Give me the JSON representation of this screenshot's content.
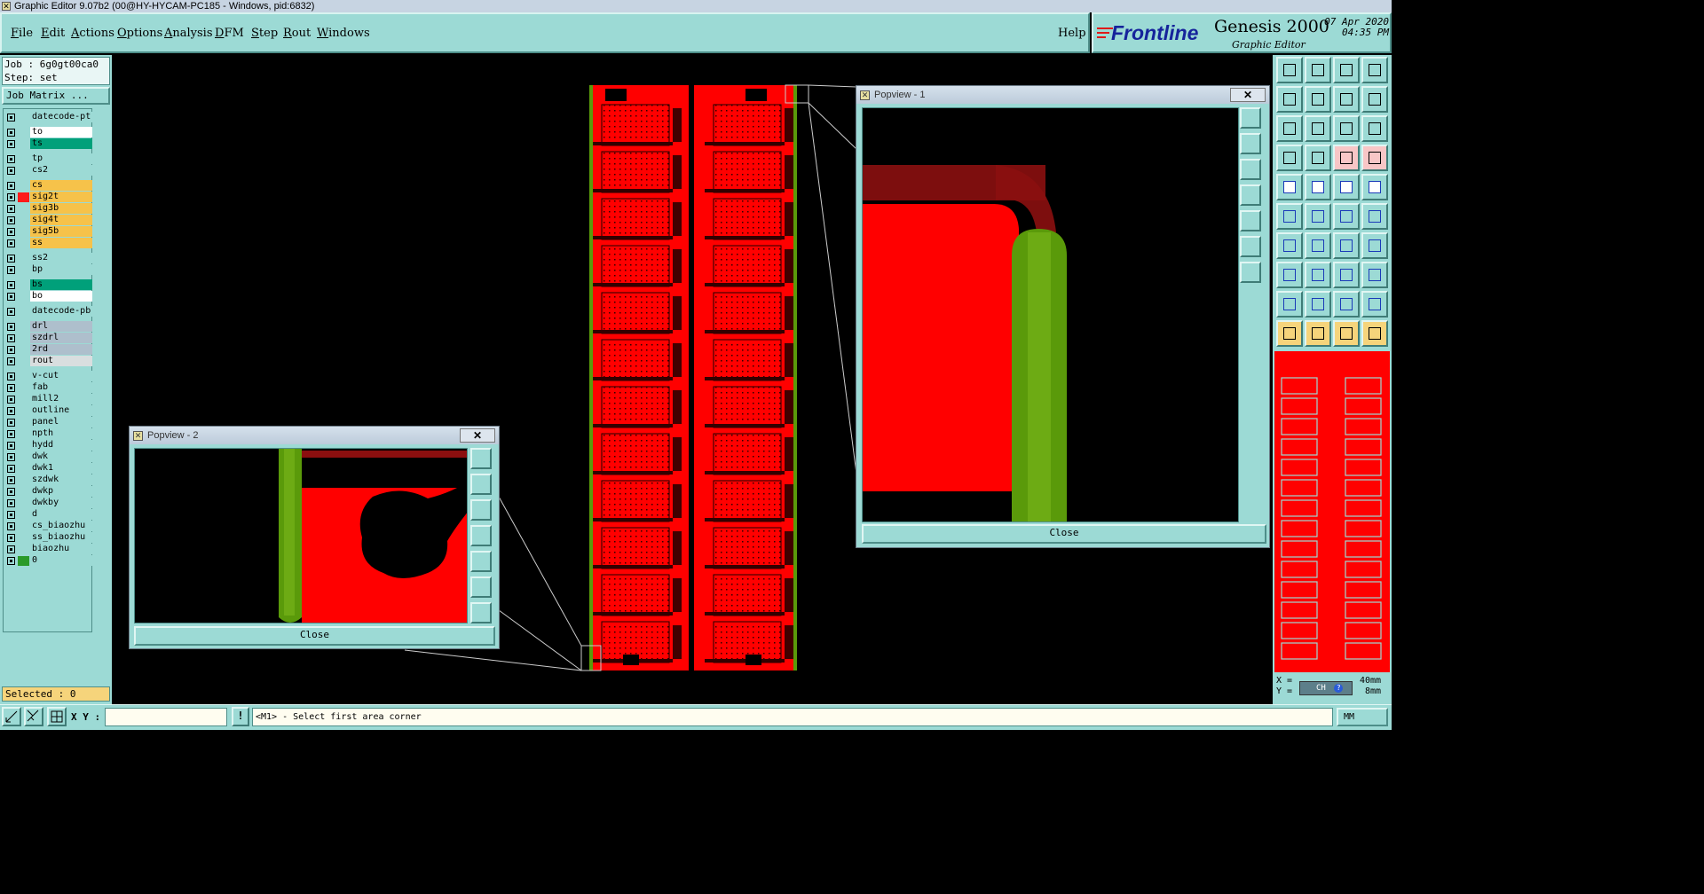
{
  "window": {
    "title": "Graphic Editor 9.07b2 (00@HY-HYCAM-PC185 - Windows, pid:6832)"
  },
  "menu": [
    {
      "label": "File",
      "ul": "F",
      "rest": "ile"
    },
    {
      "label": "Edit",
      "ul": "E",
      "rest": "dit"
    },
    {
      "label": "Actions",
      "ul": "A",
      "rest": "ctions"
    },
    {
      "label": "Options",
      "ul": "O",
      "rest": "ptions"
    },
    {
      "label": "Analysis",
      "ul": "A",
      "rest": "nalysis"
    },
    {
      "label": "DFM",
      "ul": "D",
      "rest": "FM"
    },
    {
      "label": "Step",
      "ul": "S",
      "rest": "tep"
    },
    {
      "label": "Rout",
      "ul": "R",
      "rest": "out"
    },
    {
      "label": "Windows",
      "ul": "W",
      "rest": "indows"
    }
  ],
  "help_label": "Help",
  "brand": {
    "logo": "Frontline",
    "product": "Genesis 2000",
    "editor": "Graphic Editor",
    "date": "07 Apr 2020",
    "time": "04:35 PM"
  },
  "job": {
    "job_line": "Job : 6g0gt00ca0",
    "step_line": "Step: set",
    "matrix_button": "Job Matrix ..."
  },
  "layers": [
    {
      "name": "datecode-pt",
      "color": "#9cdad5",
      "row_bg": "#9cdad5"
    },
    {
      "name": "to",
      "color": "#9cdad5",
      "row_bg": "#ffffff"
    },
    {
      "name": "ts",
      "color": "#9cdad5",
      "row_bg": "#00a07a"
    },
    {
      "name": "tp",
      "color": "#9cdad5",
      "row_bg": "#9cdad5"
    },
    {
      "name": "cs2",
      "color": "#9cdad5",
      "row_bg": "#9cdad5"
    },
    {
      "name": "cs",
      "color": "#9cdad5",
      "row_bg": "#f6c24a"
    },
    {
      "name": "sig2t",
      "color": "#ff1a1a",
      "row_bg": "#f6c24a"
    },
    {
      "name": "sig3b",
      "color": "#9cdad5",
      "row_bg": "#f6c24a"
    },
    {
      "name": "sig4t",
      "color": "#9cdad5",
      "row_bg": "#f6c24a"
    },
    {
      "name": "sig5b",
      "color": "#9cdad5",
      "row_bg": "#f6c24a"
    },
    {
      "name": "ss",
      "color": "#9cdad5",
      "row_bg": "#f6c24a"
    },
    {
      "name": "ss2",
      "color": "#9cdad5",
      "row_bg": "#9cdad5"
    },
    {
      "name": "bp",
      "color": "#9cdad5",
      "row_bg": "#9cdad5"
    },
    {
      "name": "bs",
      "color": "#9cdad5",
      "row_bg": "#00a07a"
    },
    {
      "name": "bo",
      "color": "#9cdad5",
      "row_bg": "#ffffff"
    },
    {
      "name": "datecode-pb",
      "color": "#9cdad5",
      "row_bg": "#9cdad5"
    },
    {
      "name": "drl",
      "color": "#9cdad5",
      "row_bg": "#aebfcc"
    },
    {
      "name": "szdrl",
      "color": "#9cdad5",
      "row_bg": "#aebfcc"
    },
    {
      "name": "2rd",
      "color": "#9cdad5",
      "row_bg": "#aebfcc"
    },
    {
      "name": "rout",
      "color": "#9cdad5",
      "row_bg": "#d9dedf"
    },
    {
      "name": "v-cut",
      "color": "#9cdad5",
      "row_bg": "#9cdad5"
    },
    {
      "name": "fab",
      "color": "#9cdad5",
      "row_bg": "#9cdad5"
    },
    {
      "name": "mill2",
      "color": "#9cdad5",
      "row_bg": "#9cdad5"
    },
    {
      "name": "outline",
      "color": "#9cdad5",
      "row_bg": "#9cdad5"
    },
    {
      "name": "panel",
      "color": "#9cdad5",
      "row_bg": "#9cdad5"
    },
    {
      "name": "npth",
      "color": "#9cdad5",
      "row_bg": "#9cdad5"
    },
    {
      "name": "hydd",
      "color": "#9cdad5",
      "row_bg": "#9cdad5"
    },
    {
      "name": "dwk",
      "color": "#9cdad5",
      "row_bg": "#9cdad5"
    },
    {
      "name": "dwk1",
      "color": "#9cdad5",
      "row_bg": "#9cdad5"
    },
    {
      "name": "szdwk",
      "color": "#9cdad5",
      "row_bg": "#9cdad5"
    },
    {
      "name": "dwkp",
      "color": "#9cdad5",
      "row_bg": "#9cdad5"
    },
    {
      "name": "dwkby",
      "color": "#9cdad5",
      "row_bg": "#9cdad5"
    },
    {
      "name": "d",
      "color": "#9cdad5",
      "row_bg": "#9cdad5"
    },
    {
      "name": "cs_biaozhu",
      "color": "#9cdad5",
      "row_bg": "#9cdad5"
    },
    {
      "name": "ss_biaozhu",
      "color": "#9cdad5",
      "row_bg": "#9cdad5"
    },
    {
      "name": "biaozhu",
      "color": "#9cdad5",
      "row_bg": "#9cdad5"
    },
    {
      "name": "0",
      "color": "#2a9a2a",
      "row_bg": "#9cdad5"
    }
  ],
  "selected": "Selected : 0",
  "popview1": {
    "title": "Popview - 1",
    "close": "Close",
    "close_x": "✕"
  },
  "popview2": {
    "title": "Popview - 2",
    "close": "Close",
    "close_x": "✕"
  },
  "coords": {
    "x_label": "X =",
    "y_label": "Y =",
    "x_val": "40mm",
    "y_val": "8mm",
    "unit_mode": "CH"
  },
  "bottom": {
    "xy_label": "X Y :",
    "xy_value": "",
    "prompt": "<M1> - Select first area corner",
    "units": "MM"
  },
  "colors": {
    "panel": "#9cdad5",
    "copper": "#ff0000",
    "dark_copper": "#8b0f0f",
    "green_pad": "#5a9a0a"
  }
}
